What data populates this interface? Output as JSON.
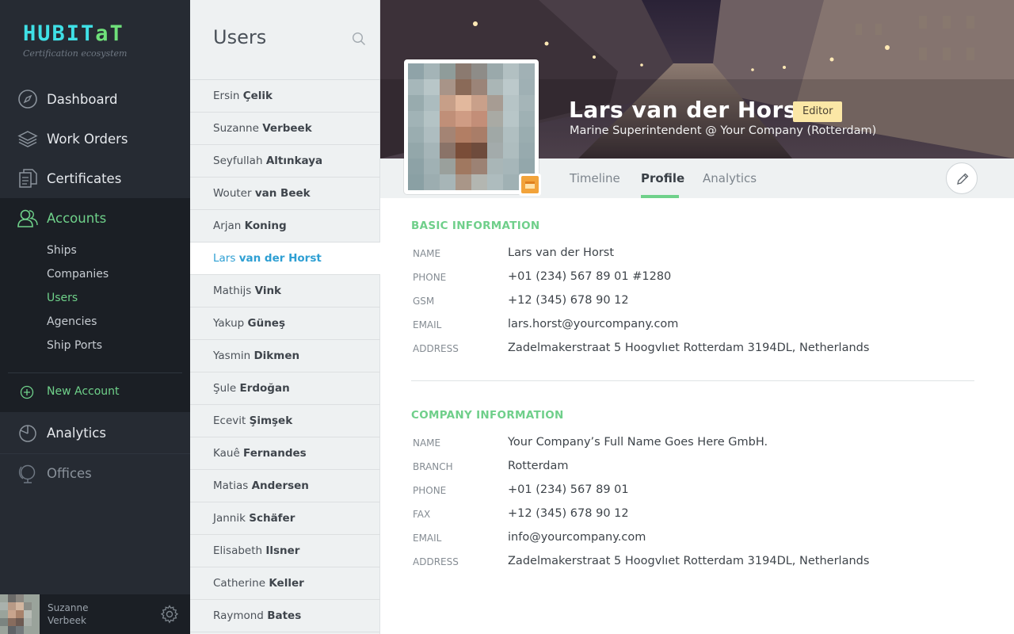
{
  "app": {
    "logo_part1": "HUBIT",
    "logo_part2": "a",
    "logo_part3": "T",
    "tagline": "Certification ecosystem"
  },
  "nav": {
    "dashboard": "Dashboard",
    "work_orders": "Work Orders",
    "certificates": "Certificates",
    "accounts": "Accounts",
    "analytics": "Analytics",
    "offices": "Offices"
  },
  "accounts_sub": {
    "ships": "Ships",
    "companies": "Companies",
    "users": "Users",
    "agencies": "Agencies",
    "ship_ports": "Ship Ports",
    "new_account": "New Account"
  },
  "current_user": {
    "first": "Suzanne",
    "last": "Verbeek"
  },
  "users_panel": {
    "title": "Users",
    "list": [
      {
        "first": "Ersin",
        "last": "Çelik"
      },
      {
        "first": "Suzanne",
        "last": "Verbeek"
      },
      {
        "first": "Seyfullah",
        "last": "Altınkaya"
      },
      {
        "first": "Wouter",
        "last": "van Beek"
      },
      {
        "first": "Arjan",
        "last": "Koning"
      },
      {
        "first": "Lars",
        "last": "van der Horst"
      },
      {
        "first": "Mathijs",
        "last": "Vink"
      },
      {
        "first": "Yakup",
        "last": "Güneş"
      },
      {
        "first": "Yasmin",
        "last": "Dikmen"
      },
      {
        "first": "Şule",
        "last": "Erdoğan"
      },
      {
        "first": "Ecevit",
        "last": "Şimşek"
      },
      {
        "first": "Kauê",
        "last": "Fernandes"
      },
      {
        "first": "Matias",
        "last": "Andersen"
      },
      {
        "first": "Jannik",
        "last": "Schäfer"
      },
      {
        "first": "Elisabeth",
        "last": "Ilsner"
      },
      {
        "first": "Catherine",
        "last": "Keller"
      },
      {
        "first": "Raymond",
        "last": "Bates"
      }
    ]
  },
  "profile": {
    "name": "Lars van der Horst",
    "role": "Editor",
    "subtitle": "Marine Superintendent @ Your Company (Rotterdam)",
    "tabs": {
      "timeline": "Timeline",
      "profile": "Profile",
      "analytics": "Analytics"
    },
    "basic": {
      "title": "BASIC INFORMATION",
      "fields": [
        {
          "label": "NAME",
          "value": "Lars van der Horst"
        },
        {
          "label": "PHONE",
          "value": "+01 (234) 567 89 01 #1280"
        },
        {
          "label": "GSM",
          "value": "+12 (345) 678 90 12"
        },
        {
          "label": "EMAIL",
          "value": "lars.horst@yourcompany.com"
        },
        {
          "label": "ADDRESS",
          "value": "Zadelmakerstraat 5 Hoogvlıet Rotterdam 3194DL, Netherlands"
        }
      ]
    },
    "company": {
      "title": "COMPANY INFORMATION",
      "fields": [
        {
          "label": "NAME",
          "value": "Your Company’s Full Name Goes Here GmbH."
        },
        {
          "label": "BRANCH",
          "value": "Rotterdam"
        },
        {
          "label": "PHONE",
          "value": "+01 (234) 567 89 01"
        },
        {
          "label": "FAX",
          "value": "+12 (345) 678 90 12"
        },
        {
          "label": "EMAIL",
          "value": "info@yourcompany.com"
        },
        {
          "label": "ADDRESS",
          "value": "Zadelmakerstraat 5 Hoogvlıet Rotterdam 3194DL, Netherlands"
        }
      ]
    }
  },
  "colors": {
    "accent_green": "#6fd18a",
    "accent_blue": "#2e9fd3",
    "sidebar_bg": "#262b33",
    "badge_bg": "#fbe7a6"
  }
}
